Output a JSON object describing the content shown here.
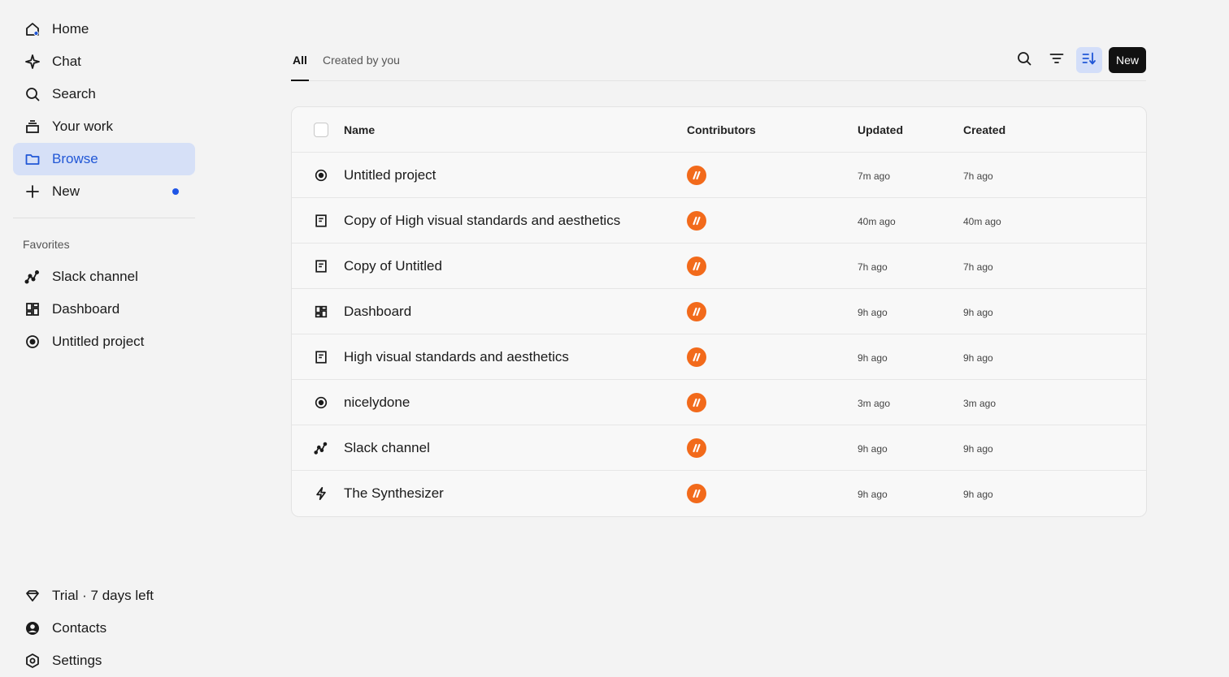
{
  "sidebar": {
    "items": [
      {
        "label": "Home",
        "icon": "home-icon"
      },
      {
        "label": "Chat",
        "icon": "sparkle-icon"
      },
      {
        "label": "Search",
        "icon": "search-icon"
      },
      {
        "label": "Your work",
        "icon": "stack-icon"
      },
      {
        "label": "Browse",
        "icon": "folder-icon",
        "active": true
      },
      {
        "label": "New",
        "icon": "plus-icon",
        "has_dot": true
      }
    ],
    "favorites_label": "Favorites",
    "favorites": [
      {
        "label": "Slack channel",
        "icon": "chart-line-icon"
      },
      {
        "label": "Dashboard",
        "icon": "dashboard-icon"
      },
      {
        "label": "Untitled project",
        "icon": "compass-icon"
      }
    ],
    "bottom": [
      {
        "label": "Trial · 7 days left",
        "icon": "diamond-icon"
      },
      {
        "label": "Contacts",
        "icon": "user-circle-icon"
      },
      {
        "label": "Settings",
        "icon": "settings-icon"
      }
    ]
  },
  "tabs": [
    {
      "label": "All",
      "active": true
    },
    {
      "label": "Created by you",
      "active": false
    }
  ],
  "toolbar": {
    "search_icon": "search-icon",
    "filter_icon": "filter-icon",
    "sort_icon": "sort-icon",
    "new_label": "New"
  },
  "table": {
    "headers": {
      "name": "Name",
      "contributors": "Contributors",
      "updated": "Updated",
      "created": "Created"
    },
    "rows": [
      {
        "icon": "compass-icon",
        "name": "Untitled project",
        "updated": "7m ago",
        "created": "7h ago"
      },
      {
        "icon": "document-icon",
        "name": "Copy of High visual standards and aesthetics",
        "updated": "40m ago",
        "created": "40m ago"
      },
      {
        "icon": "document-icon",
        "name": "Copy of Untitled",
        "updated": "7h ago",
        "created": "7h ago"
      },
      {
        "icon": "dashboard-icon",
        "name": "Dashboard",
        "updated": "9h ago",
        "created": "9h ago"
      },
      {
        "icon": "document-icon",
        "name": "High visual standards and aesthetics",
        "updated": "9h ago",
        "created": "9h ago"
      },
      {
        "icon": "compass-icon",
        "name": "nicelydone",
        "updated": "3m ago",
        "created": "3m ago"
      },
      {
        "icon": "chart-line-icon",
        "name": "Slack channel",
        "updated": "9h ago",
        "created": "9h ago"
      },
      {
        "icon": "lightning-icon",
        "name": "The Synthesizer",
        "updated": "9h ago",
        "created": "9h ago"
      }
    ]
  },
  "colors": {
    "accent": "#2157d6",
    "active_bg": "#d6e0f7",
    "avatar": "#f26a1b",
    "background": "#f3f3f3"
  }
}
